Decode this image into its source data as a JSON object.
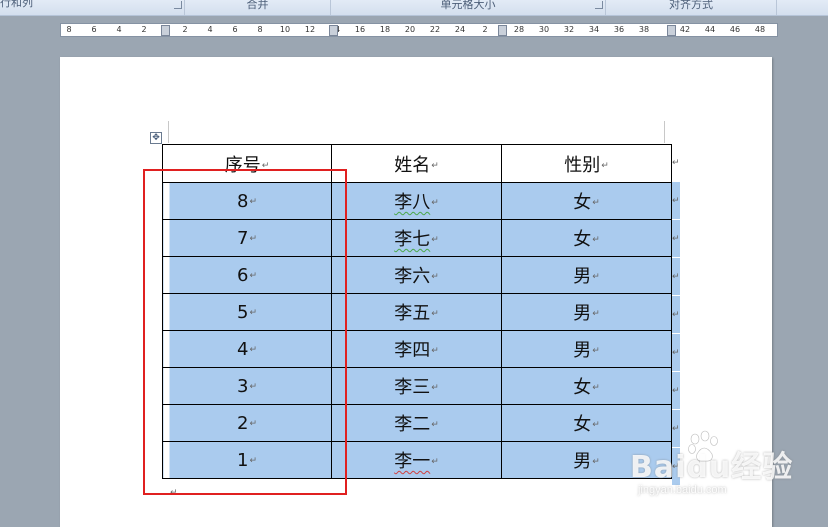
{
  "ribbon": {
    "groups": [
      "行和列",
      "合并",
      "单元格大小",
      "对齐方式"
    ]
  },
  "ruler": {
    "ticks": [
      "8",
      "6",
      "4",
      "2",
      "2",
      "4",
      "6",
      "8",
      "10",
      "12",
      "14",
      "16",
      "18",
      "20",
      "22",
      "24",
      "2",
      "28",
      "30",
      "32",
      "34",
      "36",
      "38",
      "42",
      "44",
      "46",
      "48"
    ]
  },
  "table": {
    "headers": [
      "序号",
      "姓名",
      "性别"
    ],
    "rows": [
      [
        "8",
        "李八",
        "女"
      ],
      [
        "7",
        "李七",
        "女"
      ],
      [
        "6",
        "李六",
        "男"
      ],
      [
        "5",
        "李五",
        "男"
      ],
      [
        "4",
        "李四",
        "男"
      ],
      [
        "3",
        "李三",
        "女"
      ],
      [
        "2",
        "李二",
        "女"
      ],
      [
        "1",
        "李一",
        "男"
      ]
    ]
  },
  "marks": {
    "paragraph": "↵",
    "move_handle": "✥"
  },
  "watermark": {
    "brand": "Baidu经验",
    "url": "jingyan.baidu.com"
  },
  "colors": {
    "selection": "#aacbee",
    "highlight_box": "#e02020",
    "page_bg": "#9ba6b2"
  }
}
